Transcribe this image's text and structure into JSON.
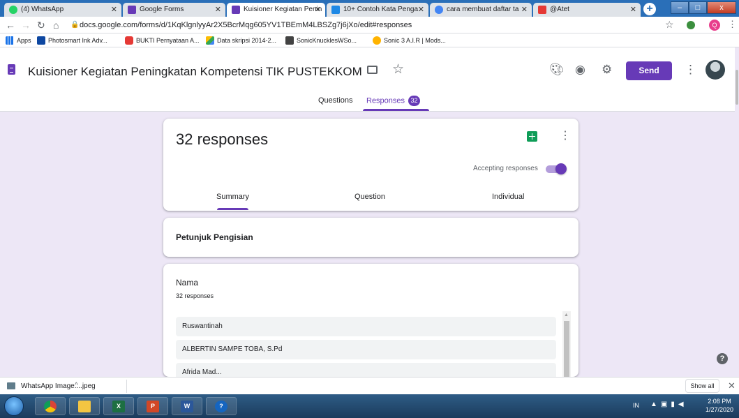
{
  "browser": {
    "tabs": [
      {
        "title": "(4) WhatsApp",
        "color": "#25d366"
      },
      {
        "title": "Google Forms",
        "color": "#673ab7"
      },
      {
        "title": "Kuisioner Kegiatan Penin",
        "color": "#673ab7"
      },
      {
        "title": "10+ Contoh Kata Penga",
        "color": "#1e88e5"
      },
      {
        "title": "cara membuat daftar ta",
        "color": "#4285f4"
      },
      {
        "title": "@Atet",
        "color": "#e53935"
      }
    ],
    "new_tab_label": "+",
    "window_buttons": [
      "–",
      "□",
      "x"
    ],
    "url": "docs.google.com/forms/d/1KqKlgnlyyAr2X5BcrMqg605YV1TBEmM4LBSZg7j6jXo/edit#responses",
    "bookmarks": [
      {
        "label": "Apps",
        "color": "#1a73e8"
      },
      {
        "label": "Photosmart Ink Adv...",
        "color": "#0d47a1"
      },
      {
        "label": "BUKTI Pernyataan A...",
        "color": "#e53935"
      },
      {
        "label": "Data skripsi 2014-2...",
        "color": "#fbbc04"
      },
      {
        "label": "SonicKnucklesWSo...",
        "color": "#424242"
      },
      {
        "label": "Sonic 3 A.I.R | Mods...",
        "color": "#ffb300"
      }
    ],
    "profile_initial": "Q"
  },
  "forms": {
    "title": "Kuisioner Kegiatan Peningkatan Kompetensi TIK PUSTEKKOM",
    "send_label": "Send",
    "tabs": {
      "questions": "Questions",
      "responses": "Responses",
      "responses_count": "32"
    },
    "accent": "#673ab7"
  },
  "summary_card": {
    "count_label": "32 responses",
    "accepting_label": "Accepting responses",
    "accepting": true,
    "subtabs": [
      "Summary",
      "Question",
      "Individual"
    ]
  },
  "petunjuk_card": {
    "title": "Petunjuk Pengisian"
  },
  "nama_card": {
    "question": "Nama",
    "subtitle": "32 responses",
    "responses": [
      "Ruswantinah",
      "ALBERTIN SAMPE TOBA, S.Pd",
      "Afrida Mad..."
    ]
  },
  "download_shelf": {
    "file_name": "WhatsApp Image....jpeg",
    "show_all_label": "Show all"
  },
  "taskbar": {
    "apps": [
      {
        "label": "Chrome",
        "glyph": "",
        "color": "#fbbc04"
      },
      {
        "label": "Explorer",
        "glyph": "",
        "color": "#f4c542"
      },
      {
        "label": "Excel",
        "glyph": "X",
        "color": "#1d6f42"
      },
      {
        "label": "PowerPoint",
        "glyph": "P",
        "color": "#d24726"
      },
      {
        "label": "Word",
        "glyph": "W",
        "color": "#2b579a"
      },
      {
        "label": "Help",
        "glyph": "?",
        "color": "#1565c0"
      }
    ],
    "language": "IN",
    "time": "2:08 PM",
    "date": "1/27/2020"
  }
}
